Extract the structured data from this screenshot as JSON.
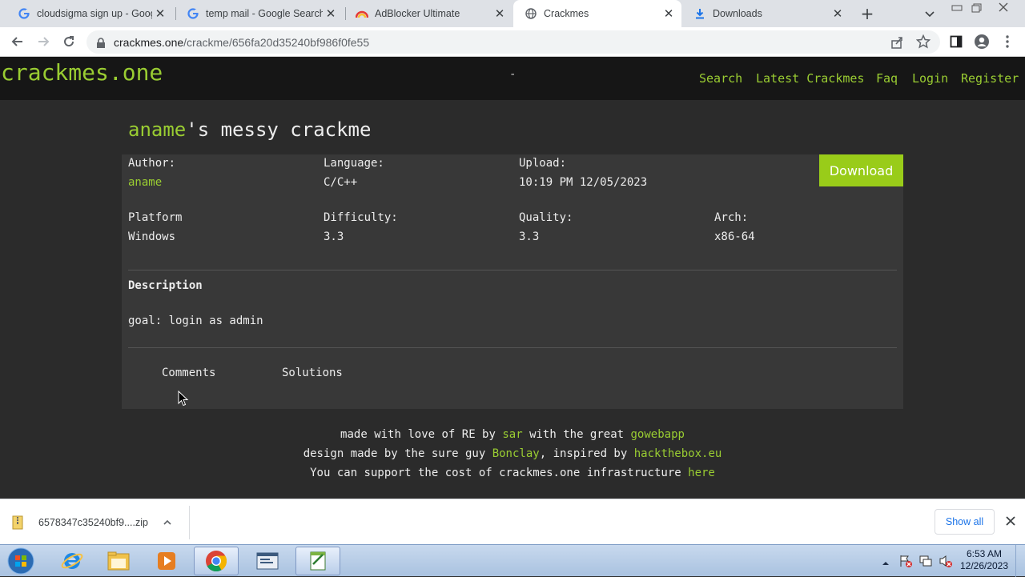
{
  "browser": {
    "tabs": [
      {
        "title": "cloudsigma sign up - Google"
      },
      {
        "title": "temp mail - Google Search"
      },
      {
        "title": "AdBlocker Ultimate"
      },
      {
        "title": "Crackmes"
      },
      {
        "title": "Downloads"
      }
    ],
    "url_host": "crackmes.one",
    "url_path": "/crackme/656fa20d35240bf986f0fe55"
  },
  "site": {
    "logo": "crackmes.one",
    "center_mark": "-",
    "nav": [
      "Search",
      "Latest Crackmes",
      "Faq",
      "Login",
      "Register"
    ]
  },
  "crackme": {
    "title_author": "aname",
    "title_rest": "'s messy crackme",
    "author_label": "Author:",
    "author": "aname",
    "language_label": "Language:",
    "language": "C/C++",
    "upload_label": "Upload:",
    "upload": "10:19 PM 12/05/2023",
    "download_label": "Download",
    "platform_label": "Platform",
    "platform": "Windows",
    "difficulty_label": "Difficulty:",
    "difficulty": "3.3",
    "quality_label": "Quality:",
    "quality": "3.3",
    "arch_label": "Arch:",
    "arch": "x86-64",
    "description_label": "Description",
    "description": "goal: login as admin",
    "tab_comments": "Comments",
    "tab_solutions": "Solutions"
  },
  "footer": {
    "l1_a": "made with love of RE by ",
    "l1_sar": "sar",
    "l1_b": " with the great ",
    "l1_gowebapp": "gowebapp",
    "l2_a": "design made by the sure guy ",
    "l2_bonclay": "Bonclay",
    "l2_b": ", inspired by ",
    "l2_htb": "hackthebox.eu",
    "l3_a": "You can support the cost of crackmes.one infrastructure ",
    "l3_here": "here"
  },
  "downloads": {
    "file": "6578347c35240bf9....zip",
    "show_all": "Show all"
  },
  "taskbar": {
    "time": "6:53 AM",
    "date": "12/26/2023"
  },
  "colors": {
    "accent": "#9acd32",
    "navbar": "#161616",
    "card": "#383838",
    "background": "#2b2b2b",
    "download_button": "#99cc19"
  }
}
